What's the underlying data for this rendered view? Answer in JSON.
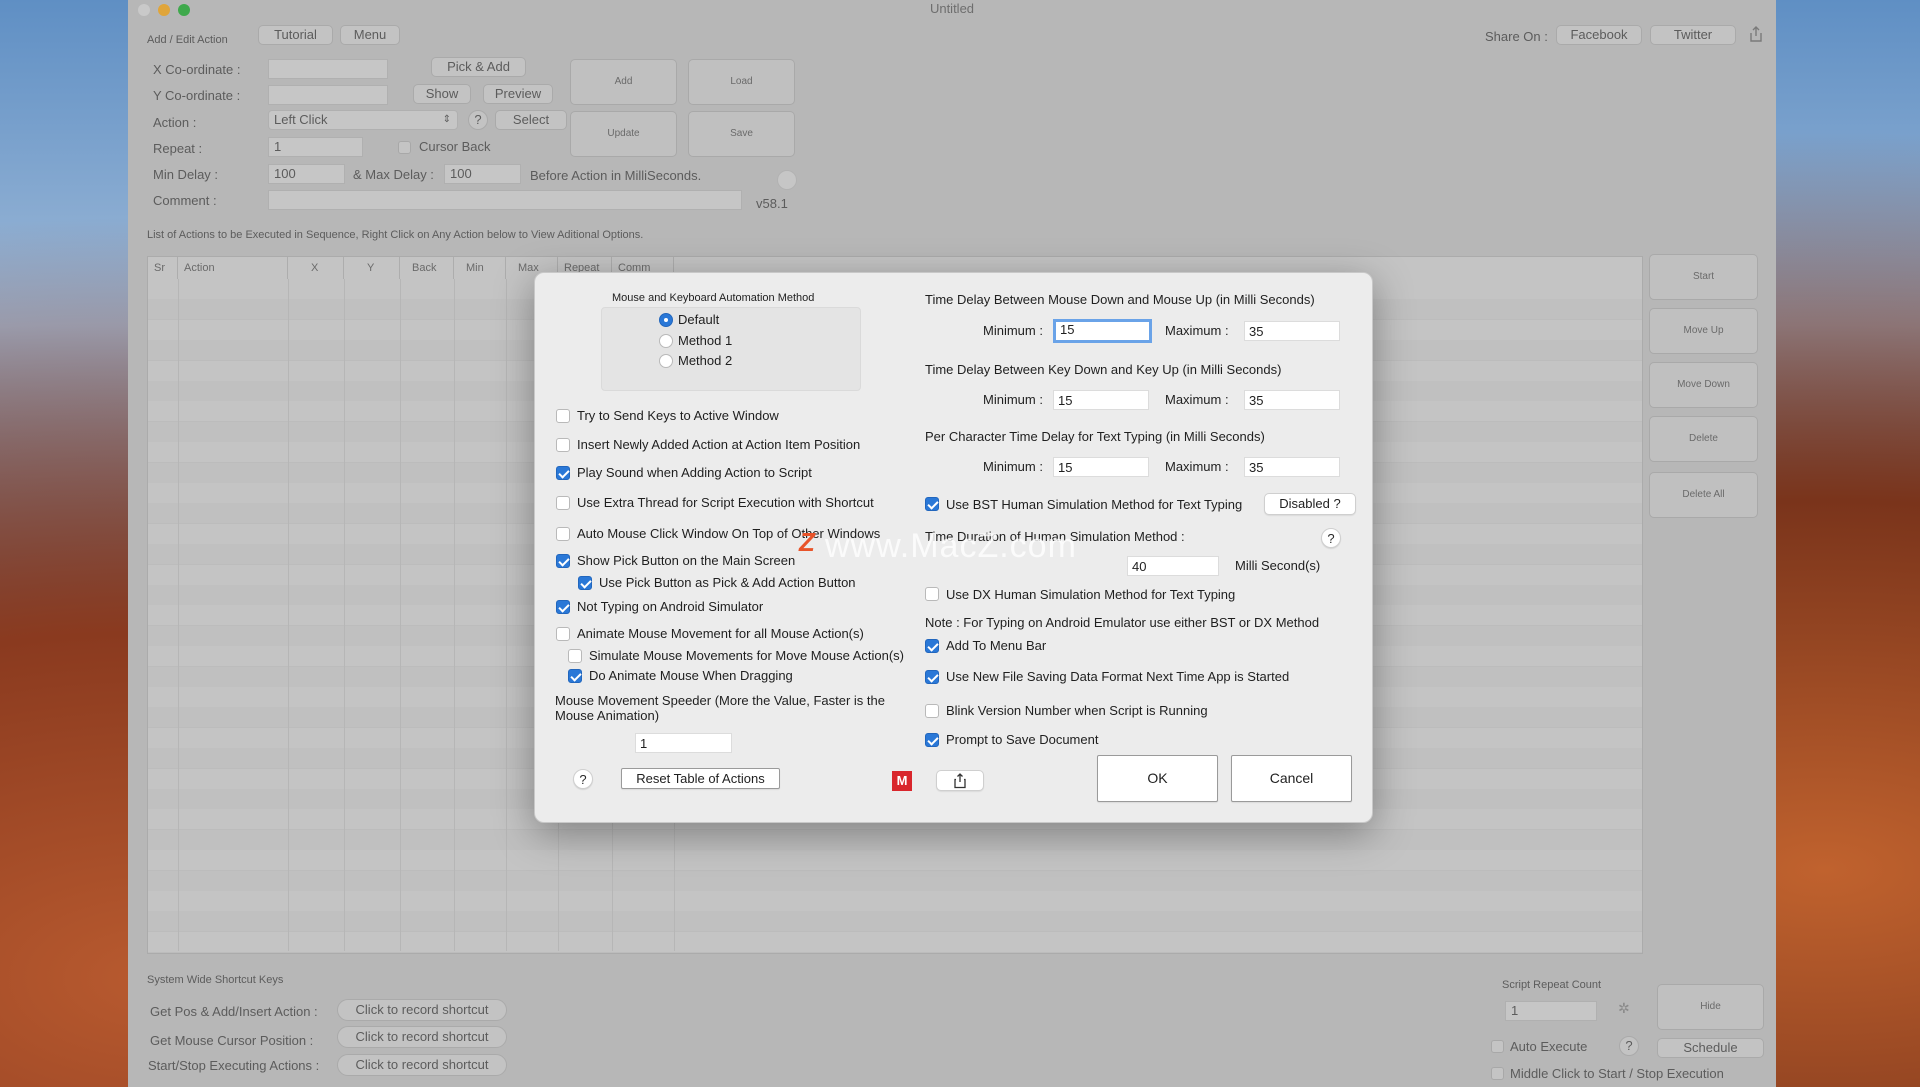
{
  "window": {
    "title": "Untitled"
  },
  "toolbar": {
    "section_label": "Add / Edit Action",
    "tutorial": "Tutorial",
    "menu": "Menu",
    "share_on": "Share On :",
    "facebook": "Facebook",
    "twitter": "Twitter"
  },
  "form": {
    "x_label": "X Co-ordinate :",
    "y_label": "Y Co-ordinate :",
    "action_label": "Action :",
    "action_value": "Left Click",
    "help": "?",
    "select": "Select",
    "repeat_label": "Repeat :",
    "repeat_value": "1",
    "cursor_back": "Cursor Back",
    "min_delay_label": "Min Delay :",
    "min_delay_value": "100",
    "max_delay_label": "& Max Delay :",
    "max_delay_value": "100",
    "before_action": "Before Action in MilliSeconds.",
    "comment_label": "Comment :",
    "version": "v58.1",
    "pick_add": "Pick & Add",
    "show": "Show",
    "preview": "Preview",
    "add": "Add",
    "load": "Load",
    "update": "Update",
    "save": "Save"
  },
  "list_caption": "List of Actions to be Executed in Sequence, Right Click on Any Action below to View Aditional Options.",
  "table": {
    "columns": [
      "Sr",
      "Action",
      "X",
      "Y",
      "Back",
      "Min",
      "Max",
      "Repeat",
      "Comm"
    ]
  },
  "side_buttons": {
    "start": "Start",
    "move_up": "Move Up",
    "move_down": "Move Down",
    "delete": "Delete",
    "delete_all": "Delete All"
  },
  "shortcuts": {
    "section": "System Wide Shortcut Keys",
    "rows": [
      {
        "label": "Get Pos & Add/Insert Action :",
        "button": "Click to record shortcut"
      },
      {
        "label": "Get Mouse Cursor Position :",
        "button": "Click to record shortcut"
      },
      {
        "label": "Start/Stop Executing Actions :",
        "button": "Click to record shortcut"
      }
    ]
  },
  "repeat_panel": {
    "label": "Script Repeat Count",
    "value": "1",
    "hide": "Hide",
    "auto_execute": "Auto Execute",
    "help": "?",
    "schedule": "Schedule",
    "middle_click": "Middle Click to Start / Stop Execution"
  },
  "dialog": {
    "method_title": "Mouse and Keyboard Automation Method",
    "methods": [
      {
        "label": "Default",
        "selected": true
      },
      {
        "label": "Method 1",
        "selected": false
      },
      {
        "label": "Method 2",
        "selected": false
      }
    ],
    "left_options": [
      {
        "label": "Try to Send Keys to Active Window",
        "checked": false
      },
      {
        "label": "Insert Newly Added Action at Action Item Position",
        "checked": false
      },
      {
        "label": "Play Sound when Adding Action to Script",
        "checked": true
      },
      {
        "label": "Use Extra Thread for Script Execution with Shortcut",
        "checked": false
      },
      {
        "label": "Auto Mouse Click Window On Top of Other Windows",
        "checked": false
      },
      {
        "label": "Show Pick Button on the Main Screen",
        "checked": true
      },
      {
        "label": "Use Pick Button as Pick & Add Action Button",
        "checked": true
      },
      {
        "label": "Not Typing on Android Simulator",
        "checked": true
      },
      {
        "label": "Animate Mouse Movement for all Mouse Action(s)",
        "checked": false
      },
      {
        "label": "Simulate Mouse Movements for Move Mouse Action(s)",
        "checked": false
      },
      {
        "label": "Do Animate Mouse When Dragging",
        "checked": true
      }
    ],
    "speeder_label": "Mouse Movement Speeder (More the Value, Faster is the Mouse Animation)",
    "speeder_value": "1",
    "help": "?",
    "reset_table": "Reset Table of Actions",
    "m_badge": "M",
    "mouse_delay_title": "Time Delay Between Mouse Down and Mouse Up (in Milli Seconds)",
    "key_delay_title": "Time Delay Between Key Down and Key Up (in Milli Seconds)",
    "char_delay_title": "Per Character Time Delay  for Text Typing (in Milli Seconds)",
    "minimum": "Minimum :",
    "maximum": "Maximum :",
    "mouse_min": "15",
    "mouse_max": "35",
    "key_min": "15",
    "key_max": "35",
    "char_min": "15",
    "char_max": "35",
    "bst_label": "Use BST Human Simulation Method for Text Typing",
    "bst_checked": true,
    "disabled_btn": "Disabled ?",
    "time_duration_label": "Time Duration of Human Simulation Method :",
    "duration_value": "40",
    "milli_seconds": "Milli Second(s)",
    "dx_label": "Use DX Human Simulation Method for Text Typing",
    "dx_checked": false,
    "note": "Note : For Typing on Android Emulator use either BST or DX Method",
    "right_options": [
      {
        "label": "Add To Menu Bar",
        "checked": true
      },
      {
        "label": "Use New File Saving Data Format Next Time App is Started",
        "checked": true
      },
      {
        "label": "Blink Version Number when Script is Running",
        "checked": false
      },
      {
        "label": "Prompt to Save Document",
        "checked": true
      }
    ],
    "ok": "OK",
    "cancel": "Cancel"
  },
  "watermark": "www.MacZ.com",
  "colors": {
    "accent": "#2a78d7",
    "badge_red": "#d9262c",
    "watermark_z": "#e8542a"
  }
}
